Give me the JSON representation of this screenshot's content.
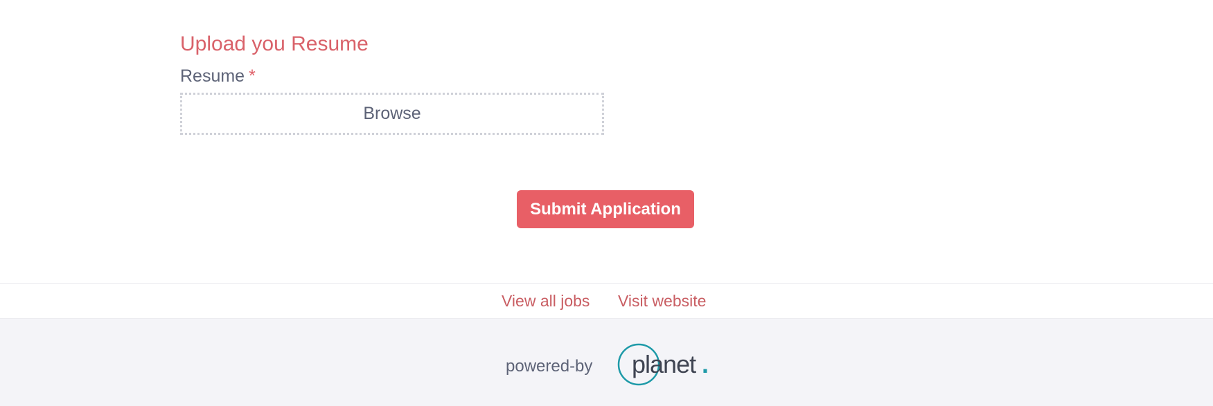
{
  "upload_section": {
    "title": "Upload you Resume",
    "field_label": "Resume",
    "required_marker": "*",
    "browse_label": "Browse"
  },
  "actions": {
    "submit_label": "Submit Application"
  },
  "footer_links": {
    "view_all_jobs": "View all jobs",
    "visit_website": "Visit website"
  },
  "footer": {
    "powered_by": "powered-by",
    "logo_text": "planet",
    "logo_dot": "."
  },
  "colors": {
    "accent": "#e85f66",
    "link": "#c95e63",
    "text": "#5d6377",
    "logo_teal": "#1e9aa8",
    "footer_bg": "#f4f4f8"
  }
}
